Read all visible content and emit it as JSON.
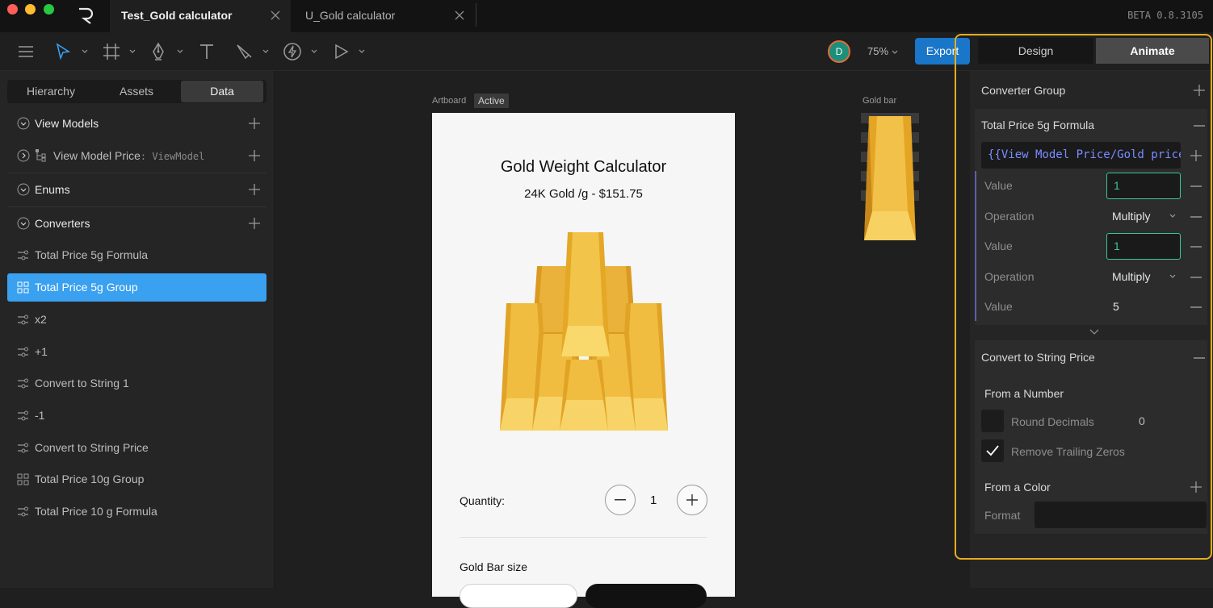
{
  "window": {
    "tabs": [
      {
        "label": "Test_Gold calculator",
        "active": true
      },
      {
        "label": "U_Gold calculator",
        "active": false
      }
    ],
    "version": "BETA 0.8.3105",
    "traffic_colors": [
      "#ff5f57",
      "#febc2e",
      "#28c840"
    ]
  },
  "toolbar": {
    "avatar_initial": "D",
    "zoom": "75%",
    "export_label": "Export",
    "mode_tabs": [
      "Design",
      "Animate"
    ],
    "active_mode": "Animate"
  },
  "left_panel": {
    "tabs": [
      "Hierarchy",
      "Assets",
      "Data"
    ],
    "active_tab": "Data",
    "view_models_label": "View Models",
    "view_model_item": {
      "name": "View Model  Price",
      "type": ": ViewModel"
    },
    "enums_label": "Enums",
    "converters_label": "Converters",
    "converters": [
      {
        "label": "Total Price 5g Formula",
        "icon": "formula-icon",
        "selected": false
      },
      {
        "label": "Total Price 5g Group",
        "icon": "group-icon",
        "selected": true
      },
      {
        "label": "x2",
        "icon": "formula-icon",
        "selected": false
      },
      {
        "label": "+1",
        "icon": "formula-icon",
        "selected": false
      },
      {
        "label": "Convert to String 1",
        "icon": "formula-icon",
        "selected": false
      },
      {
        "label": "-1",
        "icon": "formula-icon",
        "selected": false
      },
      {
        "label": "Convert to String Price",
        "icon": "formula-icon",
        "selected": false
      },
      {
        "label": "Total Price 10g Group",
        "icon": "group-icon",
        "selected": false
      },
      {
        "label": "Total Price 10 g Formula",
        "icon": "formula-icon",
        "selected": false
      }
    ]
  },
  "canvas": {
    "artboard_label": "Artboard",
    "active_badge": "Active",
    "goldbar_label": "Gold bar",
    "app": {
      "title": "Gold Weight Calculator",
      "subtitle": "24K Gold /g - $151.75",
      "quantity_label": "Quantity:",
      "quantity_value": "1",
      "bar_size_label": "Gold Bar size"
    }
  },
  "right_panel": {
    "group_title": "Converter Group",
    "formula_title": "Total Price 5g Formula",
    "binding_path": "{{View Model  Price/Gold price",
    "rows": [
      {
        "label": "Value",
        "kind": "input",
        "value": "1"
      },
      {
        "label": "Operation",
        "kind": "select",
        "value": "Multiply"
      },
      {
        "label": "Value",
        "kind": "input",
        "value": "1"
      },
      {
        "label": "Operation",
        "kind": "select",
        "value": "Multiply"
      },
      {
        "label": "Value",
        "kind": "text",
        "value": "5"
      }
    ],
    "string_title": "Convert to String Price",
    "from_number": "From a Number",
    "round_decimals": "Round Decimals",
    "round_value": "0",
    "remove_zeros": "Remove Trailing Zeros",
    "remove_zeros_checked": true,
    "from_color": "From a Color",
    "format_label": "Format",
    "highlight_color": "#e5ad22",
    "accent_color": "#3ac69d"
  }
}
